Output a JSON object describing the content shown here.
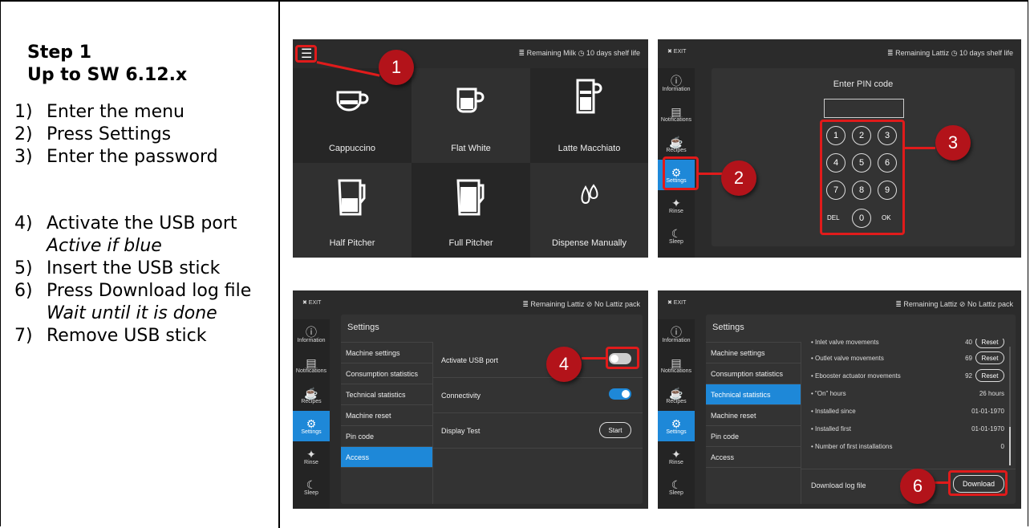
{
  "left": {
    "title_line1": "Step 1",
    "title_line2": "Up to SW 6.12.x",
    "steps": [
      {
        "num": "1)",
        "text": "Enter the menu"
      },
      {
        "num": "2)",
        "text": "Press Settings"
      },
      {
        "num": "3)",
        "text": "Enter the password"
      },
      {
        "num": "4)",
        "text": "Activate the USB port",
        "note": "Active if blue"
      },
      {
        "num": "5)",
        "text": "Insert the USB stick"
      },
      {
        "num": "6)",
        "text": "Press Download log file",
        "note": "Wait until it is done"
      },
      {
        "num": "7)",
        "text": "Remove USB stick"
      }
    ]
  },
  "badges": [
    "1",
    "2",
    "3",
    "4",
    "6"
  ],
  "shot1": {
    "top_right": "≣ Remaining Milk   ◷ 10 days shelf life",
    "tiles": [
      "Cappuccino",
      "Flat White",
      "Latte Macchiato",
      "Half Pitcher",
      "Full Pitcher",
      "Dispense Manually"
    ]
  },
  "shot2": {
    "exit": "✖ EXIT",
    "top_right": "≣ Remaining Lattiz   ◷ 10 days shelf life",
    "title": "Enter PIN code",
    "keys": [
      "1",
      "2",
      "3",
      "4",
      "5",
      "6",
      "7",
      "8",
      "9",
      "0"
    ],
    "del": "DEL",
    "ok": "OK"
  },
  "sidebar": [
    "Information",
    "Notifications",
    "Recipes",
    "Settings",
    "Rinse",
    "Sleep"
  ],
  "shot3": {
    "exit": "✖ EXIT",
    "top_right": "≣ Remaining Lattiz   ⊘ No Lattiz pack",
    "header": "Settings",
    "menu": [
      "Machine settings",
      "Consumption statistics",
      "Technical statistics",
      "Machine reset",
      "Pin code",
      "Access"
    ],
    "rows": [
      "Activate USB port",
      "Connectivity",
      "Display Test"
    ],
    "start": "Start"
  },
  "shot4": {
    "exit": "✖ EXIT",
    "top_right": "≣ Remaining Lattiz   ⊘ No Lattiz pack",
    "header": "Settings",
    "menu": [
      "Machine settings",
      "Consumption statistics",
      "Technical statistics",
      "Machine reset",
      "Pin code",
      "Access"
    ],
    "stats": [
      {
        "label": "• Inlet valve movements",
        "value": "40",
        "reset": "Reset"
      },
      {
        "label": "• Outlet valve movements",
        "value": "69",
        "reset": "Reset"
      },
      {
        "label": "• Ebooster actuator movements",
        "value": "92",
        "reset": "Reset"
      },
      {
        "label": "• \"On\" hours",
        "value": "26 hours"
      },
      {
        "label": "• Installed since",
        "value": "01-01-1970"
      },
      {
        "label": "• Installed first",
        "value": "01-01-1970"
      },
      {
        "label": "• Number of first installations",
        "value": "0"
      }
    ],
    "download_label": "Download log file",
    "download_button": "Download"
  }
}
